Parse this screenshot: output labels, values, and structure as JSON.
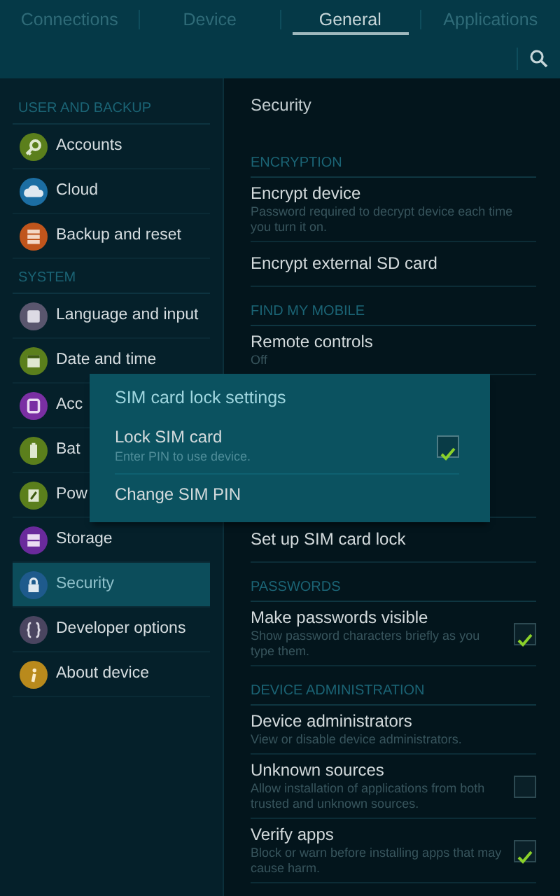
{
  "tabs": [
    {
      "label": "Connections",
      "selected": false
    },
    {
      "label": "Device",
      "selected": false
    },
    {
      "label": "General",
      "selected": true
    },
    {
      "label": "Applications",
      "selected": false
    }
  ],
  "sidebar": {
    "sections": [
      {
        "header": "USER AND BACKUP",
        "items": [
          {
            "label": "Accounts",
            "color": "#5b7f1c",
            "selected": false
          },
          {
            "label": "Cloud",
            "color": "#1c6ea3",
            "selected": false
          },
          {
            "label": "Backup and reset",
            "color": "#c0551c",
            "selected": false
          }
        ]
      },
      {
        "header": "SYSTEM",
        "items": [
          {
            "label": "Language and input",
            "color": "#5a566e",
            "selected": false
          },
          {
            "label": "Date and time",
            "color": "#5b7f1c",
            "selected": false
          },
          {
            "label": "Acc",
            "color": "#7a2fa3",
            "selected": false
          },
          {
            "label": "Bat",
            "color": "#5b7f1c",
            "selected": false
          },
          {
            "label": "Pow",
            "color": "#5b7f1c",
            "selected": false
          },
          {
            "label": "Storage",
            "color": "#6a2a9c",
            "selected": false
          },
          {
            "label": "Security",
            "color": "#1e5a8c",
            "selected": true
          },
          {
            "label": "Developer options",
            "color": "#4a4560",
            "selected": false
          },
          {
            "label": "About device",
            "color": "#b98a1c",
            "selected": false
          }
        ]
      }
    ]
  },
  "detail": {
    "title": "Security",
    "sections": [
      {
        "header": "ENCRYPTION",
        "items": [
          {
            "kind": "plain",
            "label": "Encrypt device",
            "summary": "Password required to decrypt device each time you turn it on."
          },
          {
            "kind": "plain",
            "label": "Encrypt external SD card"
          }
        ]
      },
      {
        "header": "FIND MY MOBILE",
        "items": [
          {
            "kind": "plain",
            "label": "Remote controls",
            "summary": "Off"
          }
        ]
      },
      {
        "items": [
          {
            "kind": "plain",
            "label": "Set up SIM card lock"
          }
        ]
      },
      {
        "header": "PASSWORDS",
        "items": [
          {
            "kind": "checkbox",
            "label": "Make passwords visible",
            "summary": "Show password characters briefly as you type them.",
            "checked": true
          }
        ]
      },
      {
        "header": "DEVICE ADMINISTRATION",
        "items": [
          {
            "kind": "plain",
            "label": "Device administrators",
            "summary": "View or disable device administrators."
          },
          {
            "kind": "checkbox",
            "label": "Unknown sources",
            "summary": "Allow installation of applications from both trusted and unknown sources.",
            "checked": false
          },
          {
            "kind": "checkbox",
            "label": "Verify apps",
            "summary": "Block or warn before installing apps that may cause harm.",
            "checked": true
          }
        ]
      }
    ]
  },
  "dialog": {
    "title": "SIM card lock settings",
    "items": [
      {
        "kind": "checkbox",
        "label": "Lock SIM card",
        "summary": "Enter PIN to use device.",
        "checked": true
      },
      {
        "kind": "plain",
        "label": "Change SIM PIN"
      }
    ]
  }
}
